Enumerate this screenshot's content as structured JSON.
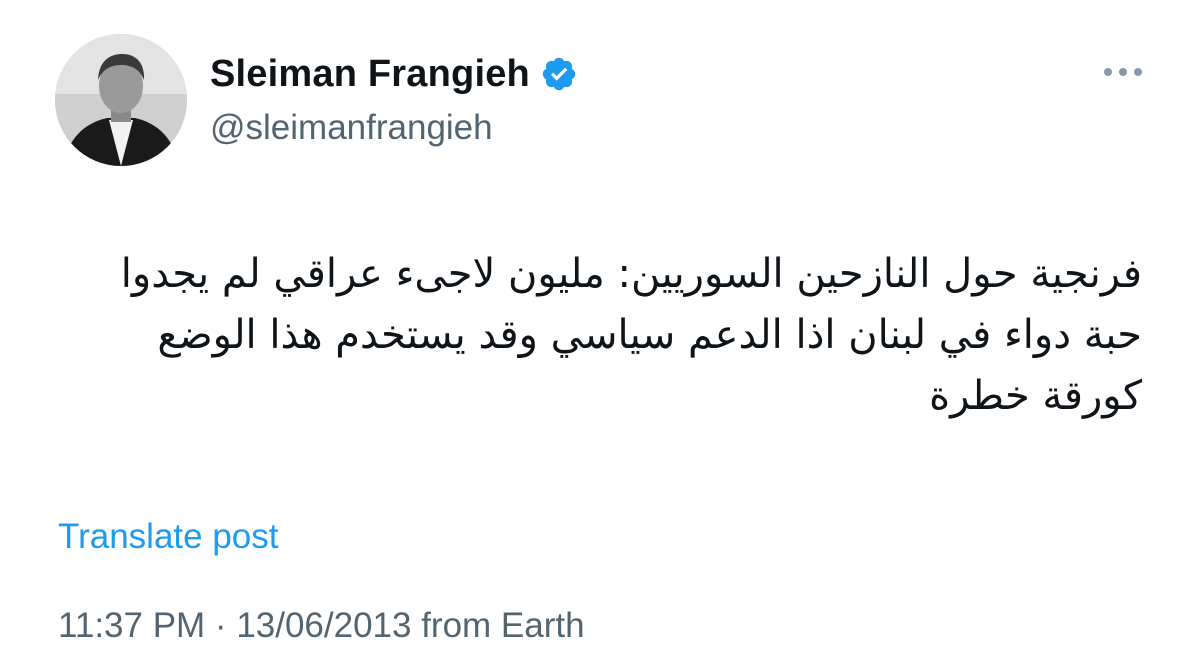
{
  "author": {
    "display_name": "Sleiman Frangieh",
    "handle": "@sleimanfrangieh",
    "verified": true,
    "avatar_icon": "profile-photo"
  },
  "tweet": {
    "text": "فرنجية حول النازحين السوريين: مليون لاجىء عراقي لم يجدوا حبة دواء في لبنان اذا الدعم سياسي وقد يستخدم هذا الوضع كورقة خطرة",
    "translate_label": "Translate post",
    "timestamp": "11:37 PM · 13/06/2013 from Earth"
  },
  "icons": {
    "more": "more-horizontal-icon",
    "verified": "verified-badge-icon"
  },
  "colors": {
    "accent": "#1d9bf0",
    "secondary_text": "#536471",
    "primary_text": "#0f1419"
  }
}
